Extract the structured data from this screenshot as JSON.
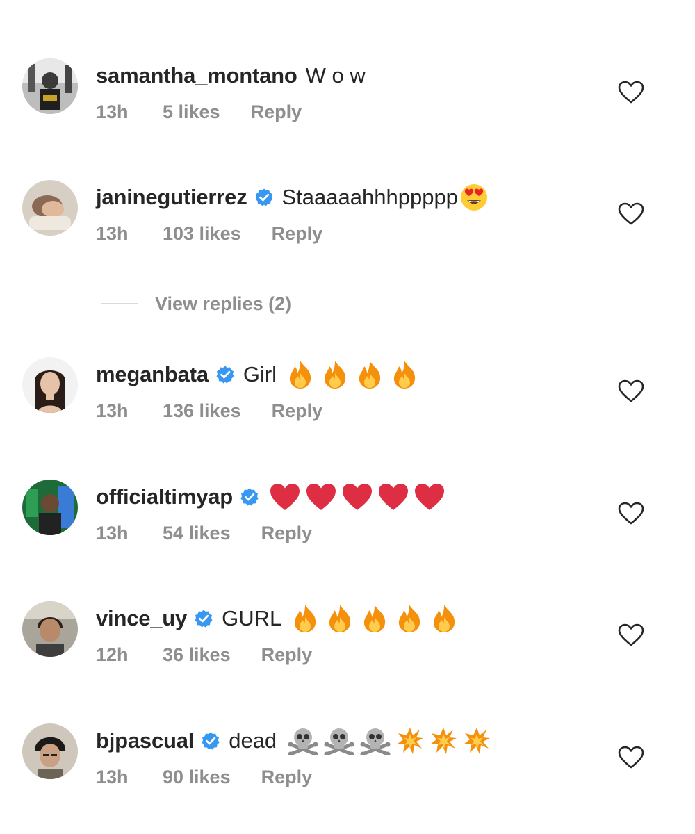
{
  "comments": [
    {
      "username": "samantha_montano",
      "verified": false,
      "text": "W o w",
      "emojis": [],
      "time": "13h",
      "likes": "5 likes",
      "reply_label": "Reply"
    },
    {
      "username": "janinegutierrez",
      "verified": true,
      "text": "Staaaaahhhppppp",
      "emojis": [
        "heart-eyes"
      ],
      "time": "13h",
      "likes": "103 likes",
      "reply_label": "Reply"
    },
    {
      "username": "meganbata",
      "verified": true,
      "text": "Girl",
      "emojis": [
        "fire",
        "fire",
        "fire",
        "fire"
      ],
      "time": "13h",
      "likes": "136 likes",
      "reply_label": "Reply"
    },
    {
      "username": "officialtimyap",
      "verified": true,
      "text": "",
      "emojis": [
        "red-heart",
        "red-heart",
        "red-heart",
        "red-heart",
        "red-heart"
      ],
      "time": "13h",
      "likes": "54 likes",
      "reply_label": "Reply"
    },
    {
      "username": "vince_uy",
      "verified": true,
      "text": "GURL",
      "emojis": [
        "fire",
        "fire",
        "fire",
        "fire",
        "fire"
      ],
      "time": "12h",
      "likes": "36 likes",
      "reply_label": "Reply"
    },
    {
      "username": "bjpascual",
      "verified": true,
      "text": "dead",
      "emojis": [
        "skull-crossbones",
        "skull-crossbones",
        "skull-crossbones",
        "collision",
        "collision",
        "collision"
      ],
      "time": "13h",
      "likes": "90 likes",
      "reply_label": "Reply"
    }
  ],
  "view_replies": {
    "label": "View replies (2)"
  },
  "colors": {
    "text": "#262626",
    "meta": "#8e8e8e",
    "verified_blue": "#3897f0",
    "divider": "#dbdbdb"
  }
}
